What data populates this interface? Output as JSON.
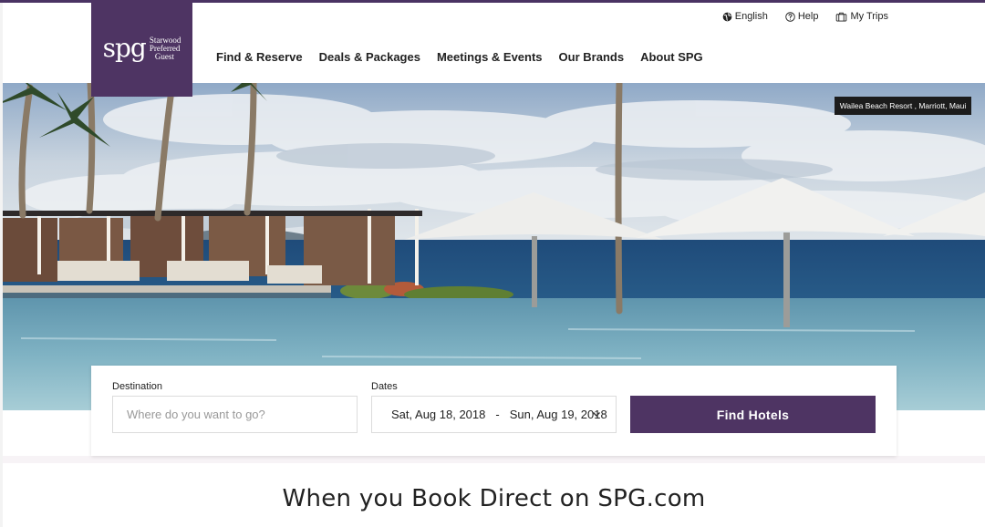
{
  "brand": {
    "mark": "spg",
    "lines": [
      "Starwood",
      "Preferred",
      "Guest"
    ],
    "color": "#4e3463"
  },
  "utility_nav": [
    {
      "label": "English",
      "icon": "globe-icon"
    },
    {
      "label": "Help",
      "icon": "help-circle-icon"
    },
    {
      "label": "My Trips",
      "icon": "suitcase-icon"
    }
  ],
  "main_nav": [
    "Find & Reserve",
    "Deals & Packages",
    "Meetings & Events",
    "Our Brands",
    "About SPG"
  ],
  "hero": {
    "credit": "Wailea Beach Resort , Marriott, Maui"
  },
  "search": {
    "destination_label": "Destination",
    "destination_placeholder": "Where do you want to go?",
    "dates_label": "Dates",
    "check_in": "Sat, Aug 18, 2018",
    "separator": "-",
    "check_out": "Sun, Aug 19, 2018",
    "button_label": "Find Hotels"
  },
  "headline": "When you Book Direct on SPG.com"
}
